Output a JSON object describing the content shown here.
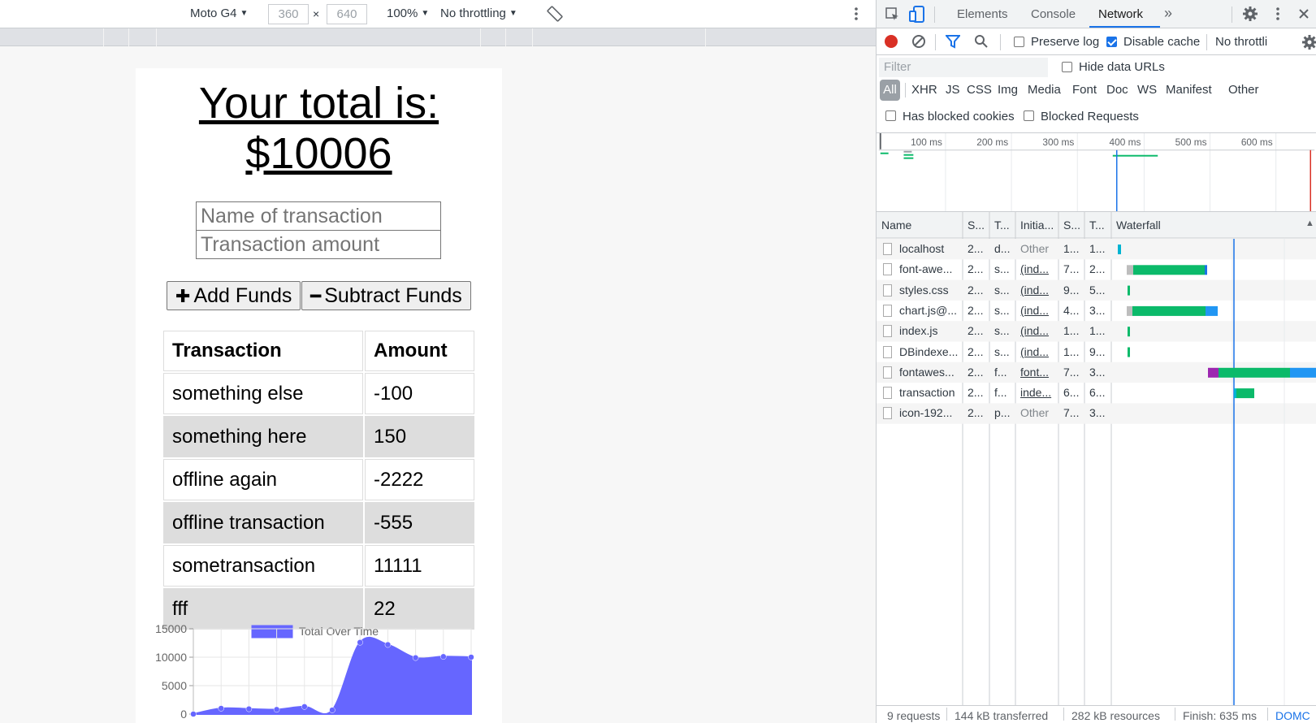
{
  "device_toolbar": {
    "device": "Moto G4",
    "width": "360",
    "times": "×",
    "height": "640",
    "zoom": "100%",
    "throttling": "No throttling"
  },
  "app": {
    "title_line1": "Your total is:",
    "title_line2": "$10006",
    "name_placeholder": "Name of transaction",
    "amount_placeholder": "Transaction amount",
    "add_label": "Add Funds",
    "subtract_label": "Subtract Funds",
    "table": {
      "headers": [
        "Transaction",
        "Amount"
      ],
      "rows": [
        {
          "name": "something else",
          "amount": "-100"
        },
        {
          "name": "something here",
          "amount": "150"
        },
        {
          "name": "offline again",
          "amount": "-2222"
        },
        {
          "name": "offline transaction",
          "amount": "-555"
        },
        {
          "name": "sometransaction",
          "amount": "11111"
        },
        {
          "name": "fff",
          "amount": "22"
        }
      ]
    }
  },
  "chart_data": {
    "type": "area",
    "legend": "Total Over Time",
    "legend_color": "#6666ff",
    "y_ticks": [
      "15000",
      "10000",
      "5000",
      "0"
    ],
    "ylim": [
      0,
      15000
    ],
    "values": [
      0,
      1000,
      900,
      800,
      1300,
      700,
      12600,
      12200,
      9900,
      10100,
      10006
    ],
    "grid": true
  },
  "devtools": {
    "tabs": [
      "Elements",
      "Console",
      "Network"
    ],
    "active_tab": "Network",
    "more_tabs": "»",
    "toolbar": {
      "preserve_log": "Preserve log",
      "disable_cache": "Disable cache",
      "throttling": "No throttli"
    },
    "filter_placeholder": "Filter",
    "hide_data_urls": "Hide data URLs",
    "types": [
      "All",
      "XHR",
      "JS",
      "CSS",
      "Img",
      "Media",
      "Font",
      "Doc",
      "WS",
      "Manifest",
      "Other"
    ],
    "has_blocked_cookies": "Has blocked cookies",
    "blocked_requests": "Blocked Requests",
    "timeline_ticks": [
      "100 ms",
      "200 ms",
      "300 ms",
      "400 ms",
      "500 ms",
      "600 ms"
    ],
    "columns": [
      "Name",
      "S...",
      "T...",
      "Initia...",
      "S...",
      "T...",
      "Waterfall"
    ],
    "requests": [
      {
        "name": "localhost",
        "status": "2...",
        "type": "d...",
        "initiator": "Other",
        "size": "1...",
        "time": "1..."
      },
      {
        "name": "font-awe...",
        "status": "2...",
        "type": "s...",
        "initiator": "(ind...",
        "size": "7...",
        "time": "2..."
      },
      {
        "name": "styles.css",
        "status": "2...",
        "type": "s...",
        "initiator": "(ind...",
        "size": "9...",
        "time": "5..."
      },
      {
        "name": "chart.js@...",
        "status": "2...",
        "type": "s...",
        "initiator": "(ind...",
        "size": "4...",
        "time": "3..."
      },
      {
        "name": "index.js",
        "status": "2...",
        "type": "s...",
        "initiator": "(ind...",
        "size": "1...",
        "time": "1..."
      },
      {
        "name": "DBindexe...",
        "status": "2...",
        "type": "s...",
        "initiator": "(ind...",
        "size": "1...",
        "time": "9..."
      },
      {
        "name": "fontawes...",
        "status": "2...",
        "type": "f...",
        "initiator": "font...",
        "size": "7...",
        "time": "3..."
      },
      {
        "name": "transaction",
        "status": "2...",
        "type": "f...",
        "initiator": "inde...",
        "size": "6...",
        "time": "6..."
      },
      {
        "name": "icon-192...",
        "status": "2...",
        "type": "p...",
        "initiator": "Other",
        "size": "7...",
        "time": "3..."
      }
    ],
    "status_bar": {
      "requests": "9 requests",
      "transferred": "144 kB transferred",
      "resources": "282 kB resources",
      "finish": "Finish: 635 ms",
      "dom": "DOMC"
    }
  }
}
